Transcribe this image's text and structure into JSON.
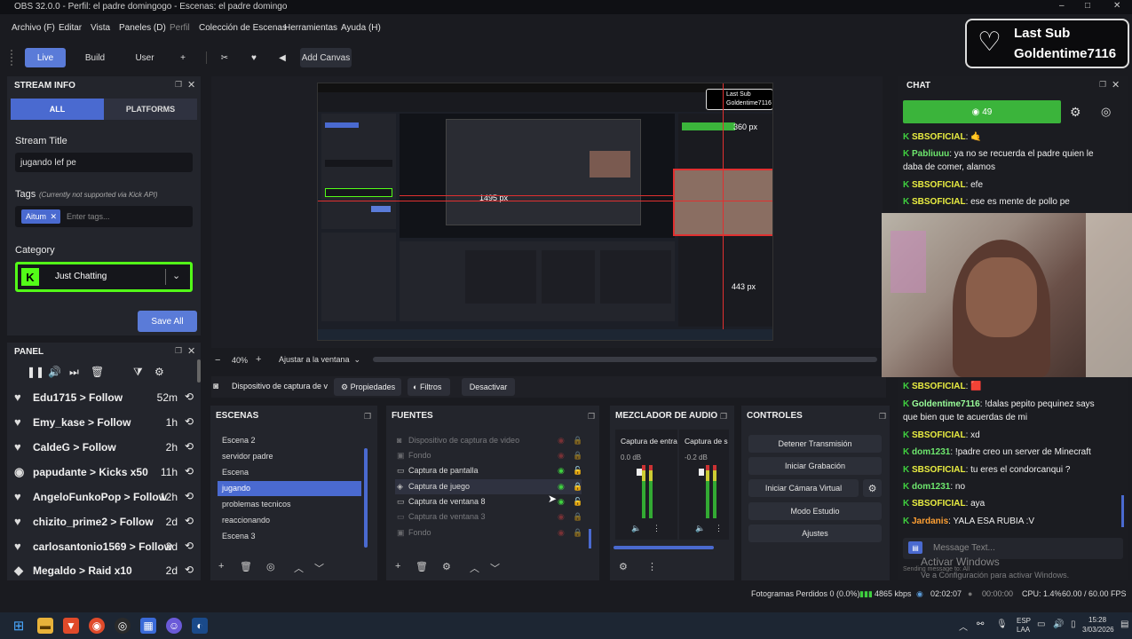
{
  "title_bar": {
    "text": "OBS 32.0.0 - Perfil: el padre domingogo - Escenas: el padre domingo",
    "minimize": "–",
    "maximize": "□",
    "close": "✕"
  },
  "menu": [
    "Archivo (F)",
    "Editar",
    "Vista",
    "Paneles (D)",
    "Perfil",
    "Colección de Escenas",
    "Herramientas",
    "Ayuda (H)"
  ],
  "toolbar": {
    "live": "Live",
    "build": "Build",
    "user": "User",
    "plus": "+",
    "add_canvas": "Add Canvas"
  },
  "last_sub": {
    "line1": "Last Sub",
    "line2": "Goldentime7116"
  },
  "stream_info": {
    "header": "STREAM INFO",
    "tab_all": "ALL",
    "tab_platforms": "PLATFORMS",
    "title_label": "Stream Title",
    "title_value": "jugando lef pe",
    "tags_label": "Tags",
    "tags_note": "(Currently not supported via Kick API)",
    "tag": "Aitum",
    "tags_placeholder": "Enter tags...",
    "category_label": "Category",
    "category_value": "Just Chatting",
    "save_all": "Save All"
  },
  "panel": {
    "header": "PANEL",
    "activities": [
      {
        "name": "Edu1715",
        "action": "Follow",
        "time": "52m"
      },
      {
        "name": "Emy_kase",
        "action": "Follow",
        "time": "1h"
      },
      {
        "name": "CaldeG",
        "action": "Follow",
        "time": "2h"
      },
      {
        "name": "papudante",
        "action": "Kicks x50",
        "time": "11h"
      },
      {
        "name": "AngeloFunkoPop",
        "action": "Follow",
        "time": "12h"
      },
      {
        "name": "chizito_prime2",
        "action": "Follow",
        "time": "2d"
      },
      {
        "name": "carlosantonio1569",
        "action": "Follow",
        "time": "2d"
      },
      {
        "name": "Megaldo",
        "action": "Raid x10",
        "time": "2d"
      }
    ]
  },
  "preview": {
    "zoom": "40%",
    "fit": "Ajustar a la ventana",
    "inner_badge_1": "Last Sub",
    "inner_badge_2": "Goldentime7116",
    "dim1": "1495 px",
    "dim2": "443 px",
    "dim3": "360 px"
  },
  "source_bar": {
    "source": "Dispositivo de captura de vi",
    "properties": "Propiedades",
    "filters": "Filtros",
    "deactivate": "Desactivar"
  },
  "scenes": {
    "header": "ESCENAS",
    "items": [
      "Escena 2",
      "servidor padre",
      "Escena",
      "jugando",
      "problemas tecnicos",
      "reaccionando",
      "Escena 3"
    ],
    "selected": "jugando"
  },
  "sources": {
    "header": "FUENTES",
    "items": [
      {
        "name": "Dispositivo de captura de video",
        "visible": false,
        "locked": true
      },
      {
        "name": "Fondo",
        "visible": false,
        "locked": true
      },
      {
        "name": "Captura de pantalla",
        "visible": true,
        "locked": false
      },
      {
        "name": "Captura de juego",
        "visible": true,
        "locked": true
      },
      {
        "name": "Captura de ventana 8",
        "visible": true,
        "locked": false
      },
      {
        "name": "Captura de ventana 3",
        "visible": false,
        "locked": true
      },
      {
        "name": "Fondo",
        "visible": false,
        "locked": true
      }
    ]
  },
  "mixer": {
    "header": "MEZCLADOR DE AUDIO",
    "channels": [
      {
        "name": "Captura de entra",
        "db": "0.0 dB"
      },
      {
        "name": "Captura de s",
        "db": "-0.2 dB"
      }
    ]
  },
  "controls": {
    "header": "CONTROLES",
    "stop": "Detener Transmisión",
    "record": "Iniciar Grabación",
    "virtual_cam": "Iniciar Cámara Virtual",
    "studio": "Modo Estudio",
    "settings": "Ajustes"
  },
  "chat": {
    "header": "CHAT",
    "viewers": "49",
    "placeholder": "Message Text...",
    "sending": "Sending message to: All",
    "messages_top": [
      {
        "user": "SBSOFICIAL",
        "text": ": 🤙"
      },
      {
        "user": "Pabliuuu",
        "text": ": ya no se recuerda el padre quien le daba de comer, alamos"
      },
      {
        "user": "SBSOFICIAL",
        "text": ": efe"
      },
      {
        "user": "SBSOFICIAL",
        "text": ": ese es mente de pollo pe"
      }
    ],
    "messages_bottom": [
      {
        "user": "SBSOFICIAL",
        "text": ": 🟥"
      },
      {
        "user": "Goldentime7116",
        "text": ": !dalas pepito pequinez says que bien que te acuerdas de mi"
      },
      {
        "user": "SBSOFICIAL",
        "text": ": xd"
      },
      {
        "user": "dom1231",
        "text": ": !padre creo un server de Minecraft"
      },
      {
        "user": "SBSOFICIAL",
        "text": ": tu eres el condorcanqui ?"
      },
      {
        "user": "dom1231",
        "text": ": no"
      },
      {
        "user": "SBSOFICIAL",
        "text": ": aya"
      },
      {
        "user": "Jardanis",
        "text": ": YALA ESA RUBIA :V"
      }
    ]
  },
  "watermark": {
    "line1": "Activar Windows",
    "line2": "Ve a Configuración para activar Windows."
  },
  "status": {
    "frames": "Fotogramas Perdidos 0 (0.0%)",
    "kbps": "4865 kbps",
    "stream_time": "02:02:07",
    "rec_time": "00:00:00",
    "cpu": "CPU: 1.4%",
    "fps": "60.00 / 60.00 FPS"
  },
  "taskbar": {
    "lang1": "ESP",
    "lang2": "LAA",
    "time": "15:28",
    "date": "3/03/2026"
  },
  "colors": {
    "accent": "#5a7bd8",
    "kick_green": "#53fc18",
    "panel_bg": "#23252c",
    "viewer_green": "#3bb43b"
  }
}
